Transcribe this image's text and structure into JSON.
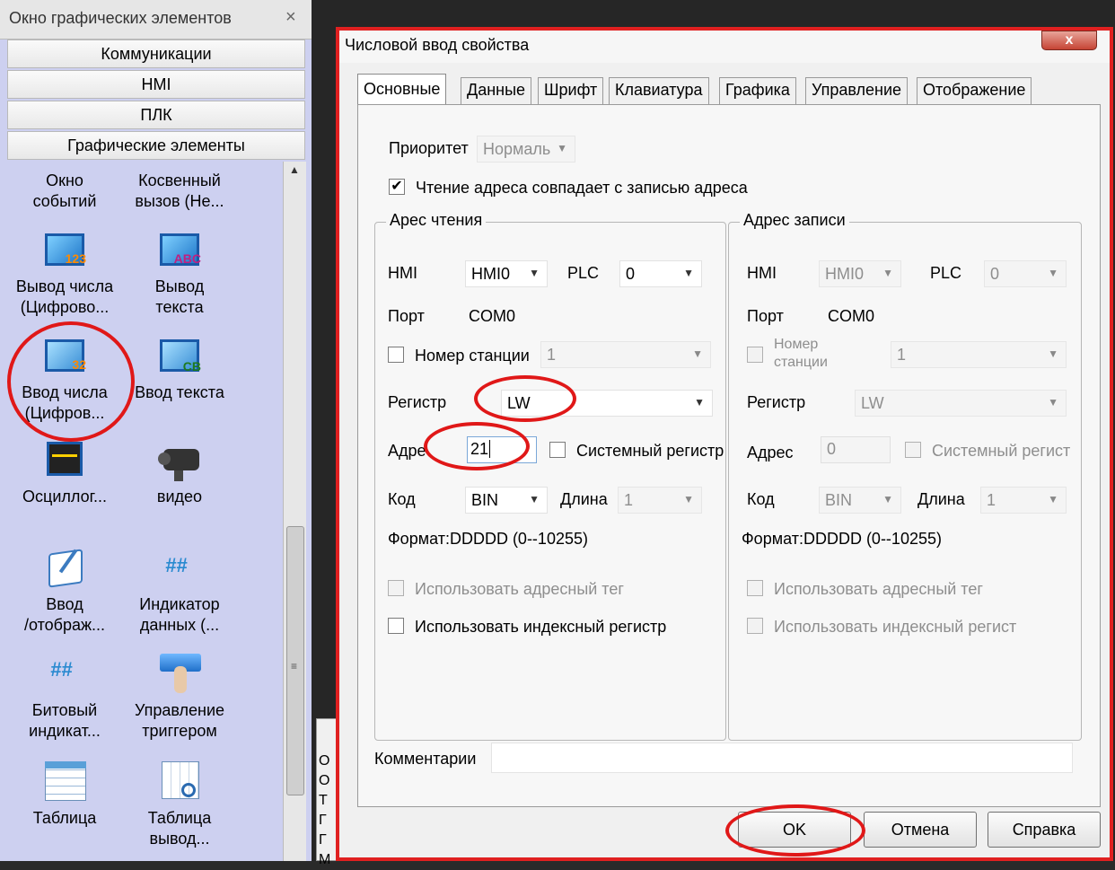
{
  "left_panel": {
    "title": "Окно графических элементов",
    "close_glyph": "×",
    "categories": [
      "Коммуникации",
      "HMI",
      "ПЛК",
      "Графические элементы"
    ],
    "tools": [
      {
        "line1": "Окно",
        "line2": "событий",
        "icon": "event-window-icon"
      },
      {
        "line1": "Косвенный",
        "line2": "вызов (Не...",
        "icon": "indirect-call-icon"
      },
      {
        "line1": "Вывод числа",
        "line2": "(Цифрово...",
        "icon": "number-display-icon",
        "badge": "123"
      },
      {
        "line1": "Вывод",
        "line2": "текста",
        "icon": "text-display-icon",
        "badge": "ABC"
      },
      {
        "line1": "Ввод числа",
        "line2": "(Цифров...",
        "icon": "number-input-icon",
        "badge": "32"
      },
      {
        "line1": "Ввод текста",
        "line2": "",
        "icon": "text-input-icon",
        "badge": "CB"
      },
      {
        "line1": "Осциллог...",
        "line2": "",
        "icon": "oscilloscope-icon"
      },
      {
        "line1": "видео",
        "line2": "",
        "icon": "video-camera-icon"
      },
      {
        "line1": "Ввод",
        "line2": "/отображ...",
        "icon": "input-display-icon"
      },
      {
        "line1": "Индикатор",
        "line2": "данных (...",
        "icon": "data-indicator-icon"
      },
      {
        "line1": "Битовый",
        "line2": "индикат...",
        "icon": "bit-indicator-icon"
      },
      {
        "line1": "Управление",
        "line2": "триггером",
        "icon": "trigger-control-icon"
      },
      {
        "line1": "Таблица",
        "line2": "",
        "icon": "table-icon"
      },
      {
        "line1": "Таблица",
        "line2": "вывод...",
        "icon": "table-output-icon"
      }
    ]
  },
  "side_strip": {
    "chars": [
      "О",
      "О",
      "Т",
      "Г",
      "Г",
      "М"
    ]
  },
  "dialog": {
    "title": "Числовой ввод свойства",
    "close_glyph": "x",
    "tabs": [
      "Основные",
      "Данные",
      "Шрифт",
      "Клавиатура",
      "Графика",
      "Управление",
      "Отображение"
    ],
    "priority_label": "Приоритет",
    "priority_value": "Нормаль",
    "same_address_label": "Чтение адреса совпадает с записью адреса",
    "same_address_checked": "✔",
    "read_group": {
      "title": "Арес чтения",
      "hmi_label": "HMI",
      "hmi_value": "HMI0",
      "plc_label": "PLC",
      "plc_value": "0",
      "port_label": "Порт",
      "port_value": "COM0",
      "station_label": "Номер станции",
      "station_value": "1",
      "register_label": "Регистр",
      "register_value": "LW",
      "address_label": "Адре",
      "address_value": "21",
      "system_register_label": "Системный регистр",
      "code_label": "Код",
      "code_value": "BIN",
      "length_label": "Длина",
      "length_value": "1",
      "format_text": "Формат:DDDDD (0--10255)",
      "use_address_tag": "Использовать адресный тег",
      "use_index_register": "Использовать индексный регистр"
    },
    "write_group": {
      "title": "Адрес записи",
      "hmi_label": "HMI",
      "hmi_value": "HMI0",
      "plc_label": "PLC",
      "plc_value": "0",
      "port_label": "Порт",
      "port_value": "COM0",
      "station_label_1": "Номер",
      "station_label_2": "станции",
      "station_value": "1",
      "register_label": "Регистр",
      "register_value": "LW",
      "address_label": "Адрес",
      "address_value": "0",
      "system_register_label": "Системный регист",
      "code_label": "Код",
      "code_value": "BIN",
      "length_label": "Длина",
      "length_value": "1",
      "format_text": "Формат:DDDDD (0--10255)",
      "use_address_tag": "Использовать адресный тег",
      "use_index_register": "Использовать индексный регист"
    },
    "comment_label": "Комментарии",
    "comment_value": "",
    "buttons": {
      "ok": "OK",
      "cancel": "Отмена",
      "help": "Справка"
    }
  },
  "colors": {
    "annotation": "#e01818",
    "panel_bg": "#cdd0f0",
    "dialog_bg": "#f0f0f0"
  }
}
